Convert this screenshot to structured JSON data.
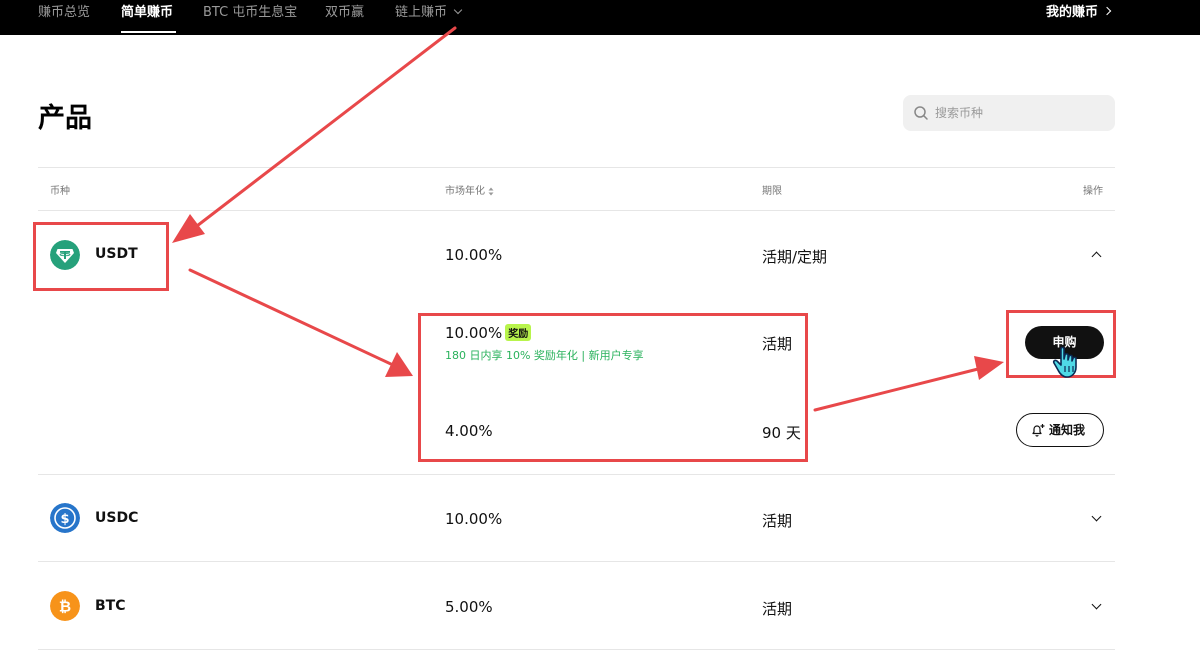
{
  "nav": {
    "items": [
      "赚币总览",
      "简单赚币",
      "BTC 屯币生息宝",
      "双币赢",
      "链上赚币"
    ],
    "active_index": 1,
    "right_link": "我的赚币"
  },
  "page": {
    "title": "产品",
    "search_placeholder": "搜索币种"
  },
  "table": {
    "headers": {
      "coin": "币种",
      "apr": "市场年化",
      "term": "期限",
      "action": "操作"
    },
    "rows": [
      {
        "coin": "USDT",
        "apr": "10.00%",
        "term": "活期/定期",
        "expanded": true,
        "color": "#26a17b"
      },
      {
        "coin": "USDC",
        "apr": "10.00%",
        "term": "活期",
        "expanded": false,
        "color": "#2775ca"
      },
      {
        "coin": "BTC",
        "apr": "5.00%",
        "term": "活期",
        "expanded": false,
        "color": "#f7931a"
      }
    ],
    "expanded_detail": {
      "flexible": {
        "apr": "10.00%",
        "badge": "奖励",
        "promo": "180 日内享 10% 奖励年化 | 新用户专享",
        "term": "活期",
        "button": "申购"
      },
      "fixed": {
        "apr": "4.00%",
        "term": "90 天",
        "button": "通知我"
      }
    }
  },
  "colors": {
    "annotation": "#e8484a",
    "badge": "#b8f44c",
    "promo": "#2ab25c"
  }
}
